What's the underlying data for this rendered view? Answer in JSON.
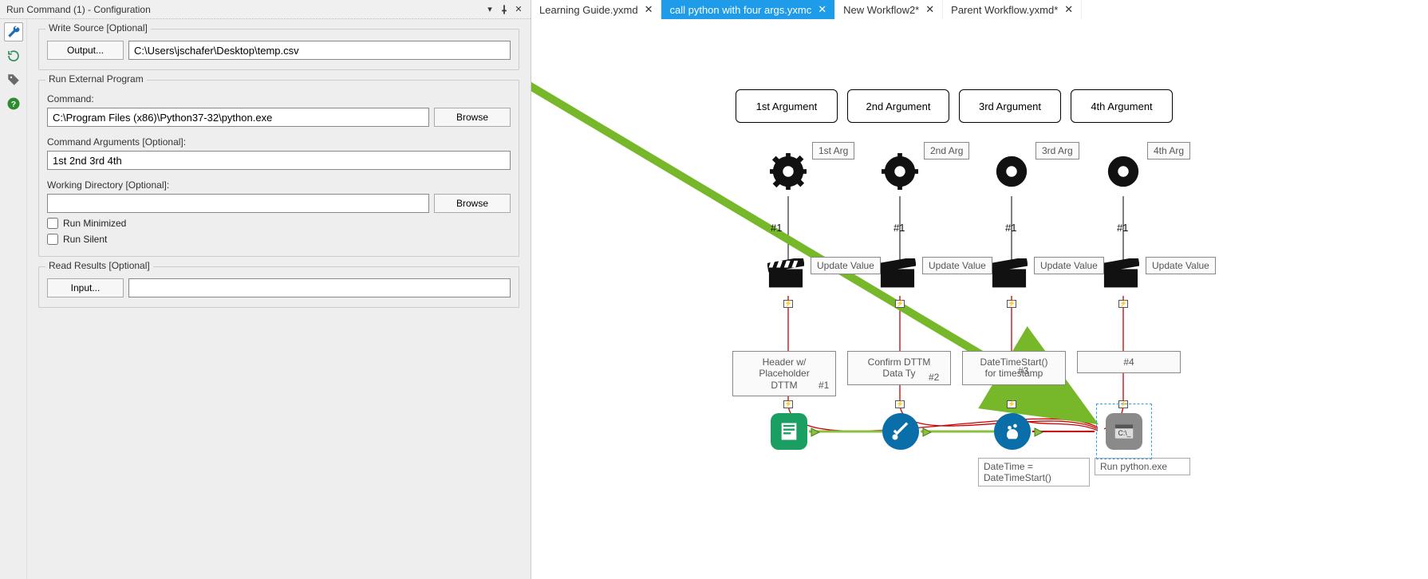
{
  "left": {
    "title": "Run Command (1) - Configuration",
    "write_source_legend": "Write Source [Optional]",
    "output_btn": "Output...",
    "output_path": "C:\\Users\\jschafer\\Desktop\\temp.csv",
    "run_ext_legend": "Run External Program",
    "command_label": "Command:",
    "command_val": "C:\\Program Files (x86)\\Python37-32\\python.exe",
    "browse": "Browse",
    "args_label": "Command Arguments [Optional]:",
    "args_val": "1st 2nd 3rd 4th",
    "workdir_label": "Working Directory [Optional]:",
    "workdir_val": "",
    "run_min": "Run Minimized",
    "run_silent": "Run Silent",
    "read_results_legend": "Read Results [Optional]",
    "input_btn": "Input..."
  },
  "tabs": [
    {
      "label": "Learning Guide.yxmd",
      "active": false
    },
    {
      "label": "call python with four args.yxmc",
      "active": true
    },
    {
      "label": "New Workflow2*",
      "active": false
    },
    {
      "label": "Parent Workflow.yxmd*",
      "active": false
    }
  ],
  "canvas": {
    "argboxes": [
      "1st Argument",
      "2nd Argument",
      "3rd Argument",
      "4th Argument"
    ],
    "argsmall": [
      "1st Arg",
      "2nd Arg",
      "3rd Arg",
      "4th Arg"
    ],
    "hashes": [
      "#1",
      "#1",
      "#1",
      "#1"
    ],
    "update": "Update Value",
    "headers": {
      "h1": "Header w/\nPlaceholder\nDTTM",
      "h2": "Confirm DTTM\nData Ty",
      "h3": "DateTimeStart()\nfor timestamp",
      "h4label": "#4"
    },
    "hash_num": [
      "#1",
      "#2",
      "#3",
      "#4"
    ],
    "datetime_caption": "DateTime =\nDateTimeStart()",
    "runpy_caption": "Run python.exe"
  }
}
